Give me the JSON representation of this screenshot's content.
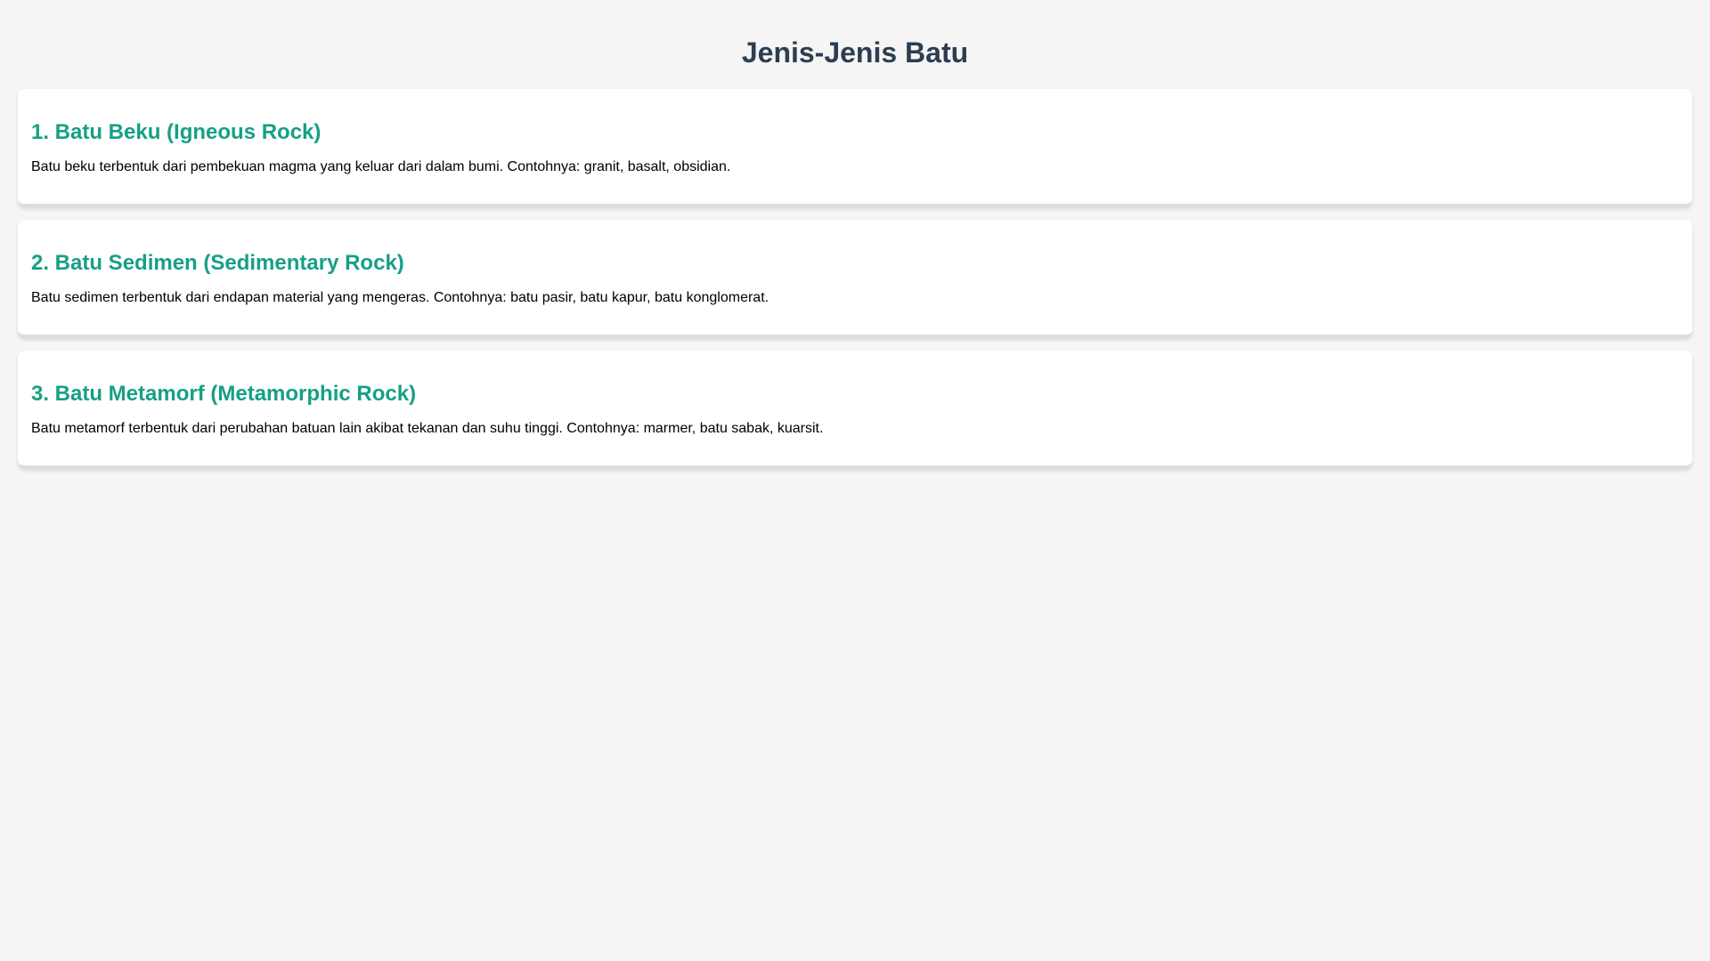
{
  "page": {
    "title": "Jenis-Jenis Batu"
  },
  "sections": [
    {
      "heading": "1. Batu Beku (Igneous Rock)",
      "text": "Batu beku terbentuk dari pembekuan magma yang keluar dari dalam bumi. Contohnya: granit, basalt, obsidian."
    },
    {
      "heading": "2. Batu Sedimen (Sedimentary Rock)",
      "text": "Batu sedimen terbentuk dari endapan material yang mengeras. Contohnya: batu pasir, batu kapur, batu konglomerat."
    },
    {
      "heading": "3. Batu Metamorf (Metamorphic Rock)",
      "text": "Batu metamorf terbentuk dari perubahan batuan lain akibat tekanan dan suhu tinggi. Contohnya: marmer, batu sabak, kuarsit."
    }
  ],
  "colors": {
    "background": "#f5f5f5",
    "title": "#2c3e50",
    "heading": "#16a085",
    "card": "#ffffff"
  }
}
